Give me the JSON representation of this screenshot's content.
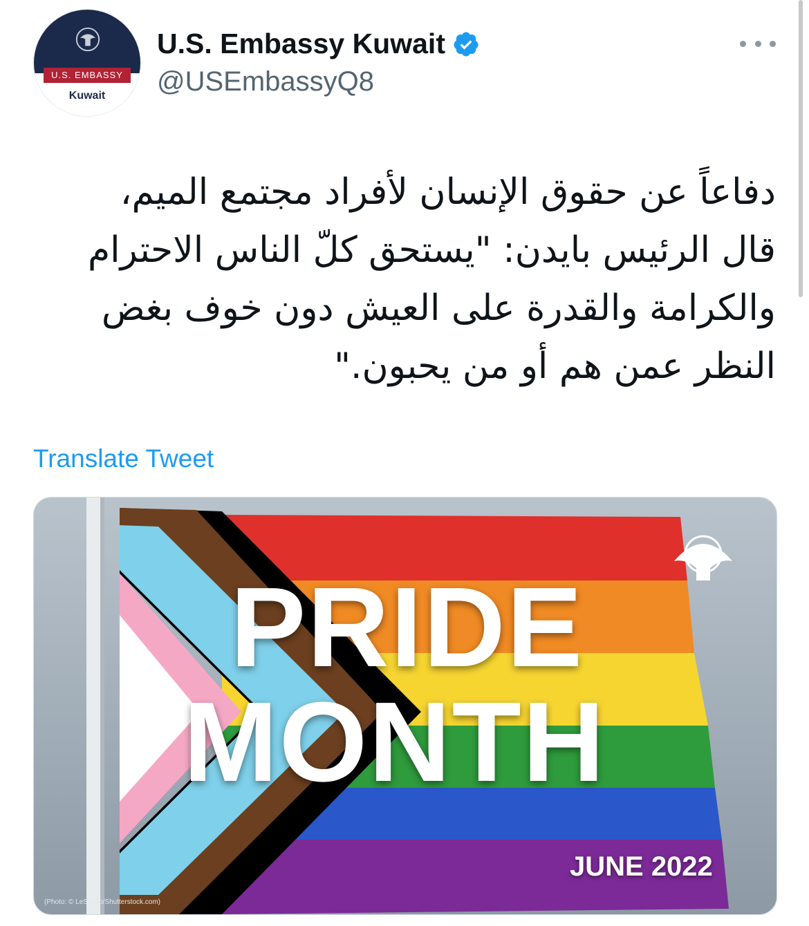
{
  "account": {
    "display_name": "U.S. Embassy Kuwait",
    "handle": "@USEmbassyQ8",
    "avatar_band": "U.S. EMBASSY",
    "avatar_city": "Kuwait",
    "verified_color": "#1d9bf0"
  },
  "tweet": {
    "text": "دفاعاً عن حقوق الإنسان لأفراد مجتمع الميم،\nقال الرئيس بايدن: \"يستحق كلّ الناس الاحترام\nوالكرامة والقدرة على العيش دون خوف بغض\nالنظر عمن هم أو من يحبون.\"",
    "translate_label": "Translate Tweet"
  },
  "media": {
    "headline_line1": "PRIDE",
    "headline_line2": "MONTH",
    "date_label": "JUNE 2022",
    "credit": "(Photo: © LeStudio/Shutterstock.com)"
  },
  "icons": {
    "more": "more-horizontal-icon",
    "verified": "verified-badge-icon",
    "seal": "embassy-seal-icon"
  }
}
